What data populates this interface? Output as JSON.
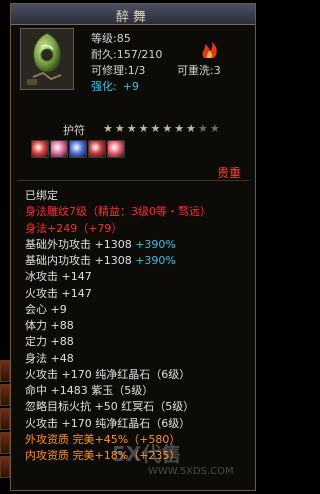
{
  "item": {
    "name": "醉舞",
    "level_label": "等级:",
    "level_value": "85",
    "durability_label": "耐久:",
    "durability_value": "157/210",
    "repair_label": "可修理:",
    "repair_value": "1/3",
    "rewash_label": "可重洗:",
    "rewash_value": "3",
    "enhance_label": "强化:",
    "enhance_value": "+9"
  },
  "amulet": {
    "label": "护符",
    "stars_total": 10,
    "stars_filled": 8,
    "rune_colors": [
      "#d84040",
      "#e070a0",
      "#5070e0",
      "#c83a3a",
      "#e86070"
    ]
  },
  "binding_note": "贵重",
  "lines": [
    {
      "text": "已绑定",
      "color": "white"
    },
    {
      "text": "身法雕纹7级（精益：3级0等・骛远）",
      "color": "red"
    },
    {
      "text": "身法+249",
      "color": "red",
      "extra": "（+79）"
    },
    {
      "text": "基础外功攻击 +1308",
      "color": "white",
      "extra": " +390%",
      "extra_color": "cyan"
    },
    {
      "text": "基础内功攻击 +1308",
      "color": "white",
      "extra": " +390%",
      "extra_color": "cyan"
    },
    {
      "text": "冰攻击 +147",
      "color": "white"
    },
    {
      "text": "火攻击 +147",
      "color": "white"
    },
    {
      "text": "会心 +9",
      "color": "white"
    },
    {
      "text": "体力 +88",
      "color": "white"
    },
    {
      "text": "定力 +88",
      "color": "white"
    },
    {
      "text": "身法 +48",
      "color": "white"
    },
    {
      "text": "火攻击 +170 纯净红晶石（6级）",
      "color": "white"
    },
    {
      "text": "命中 +1483 紫玉（5级）",
      "color": "white"
    },
    {
      "text": "忽略目标火抗 +50 红冥石（5级）",
      "color": "white"
    },
    {
      "text": "火攻击 +170 纯净红晶石（6级）",
      "color": "white"
    },
    {
      "text": "外攻资质  完美+45%（+580）",
      "color": "orange"
    },
    {
      "text": "内攻资质  完美+18%（+235）",
      "color": "orange"
    }
  ],
  "watermark": {
    "text": "5X代售",
    "url": "WWW.5XDS.COM"
  }
}
